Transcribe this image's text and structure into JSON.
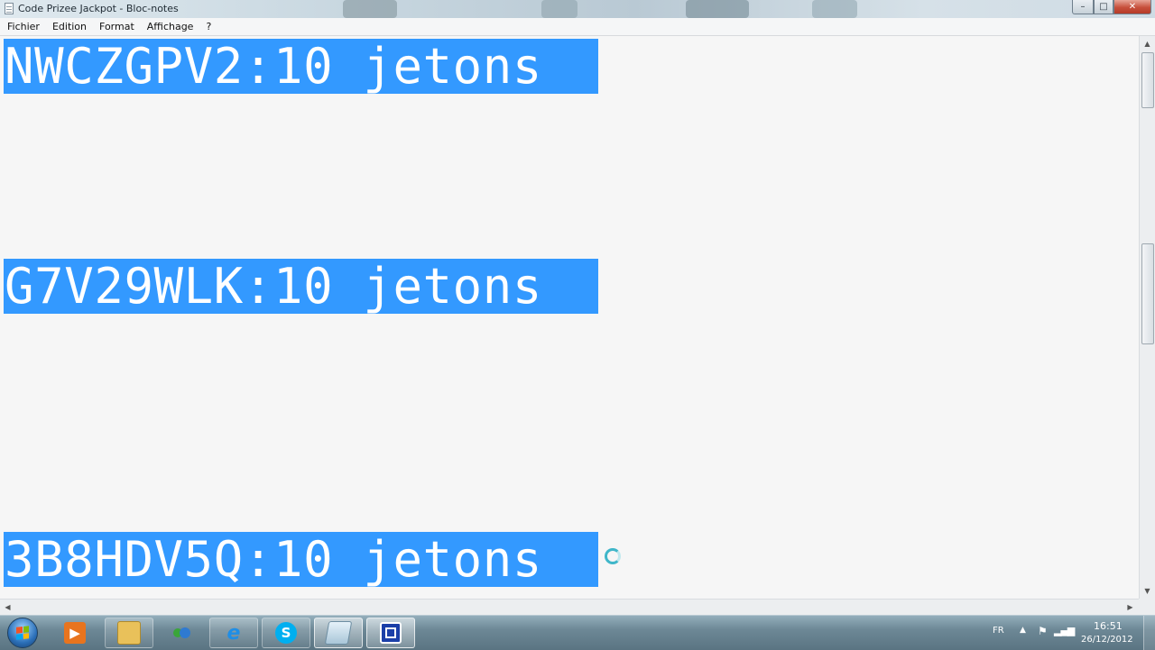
{
  "window": {
    "title": "Code Prizee Jackpot - Bloc-notes",
    "controls": {
      "minimize": "–",
      "maximize": "□",
      "close": "✕"
    }
  },
  "menu": {
    "items": [
      "Fichier",
      "Edition",
      "Format",
      "Affichage",
      "?"
    ]
  },
  "editor": {
    "lines": [
      "NWCZGPV2:10 jetons",
      "G7V29WLK:10 jetons",
      "3B8HDV5Q:10 jetons"
    ],
    "selection_color": "#3399ff"
  },
  "taskbar": {
    "apps": [
      {
        "name": "windows-media-player-icon",
        "state": "pinned"
      },
      {
        "name": "file-explorer-icon",
        "state": "pinned"
      },
      {
        "name": "messenger-icon",
        "state": "pinned"
      },
      {
        "name": "internet-explorer-icon",
        "state": "pinned"
      },
      {
        "name": "skype-icon",
        "state": "pinned"
      },
      {
        "name": "notepad-icon",
        "state": "active"
      },
      {
        "name": "screen-recorder-icon",
        "state": "active"
      }
    ],
    "tray": {
      "language": "FR",
      "time": "16:51",
      "date": "26/12/2012"
    }
  }
}
